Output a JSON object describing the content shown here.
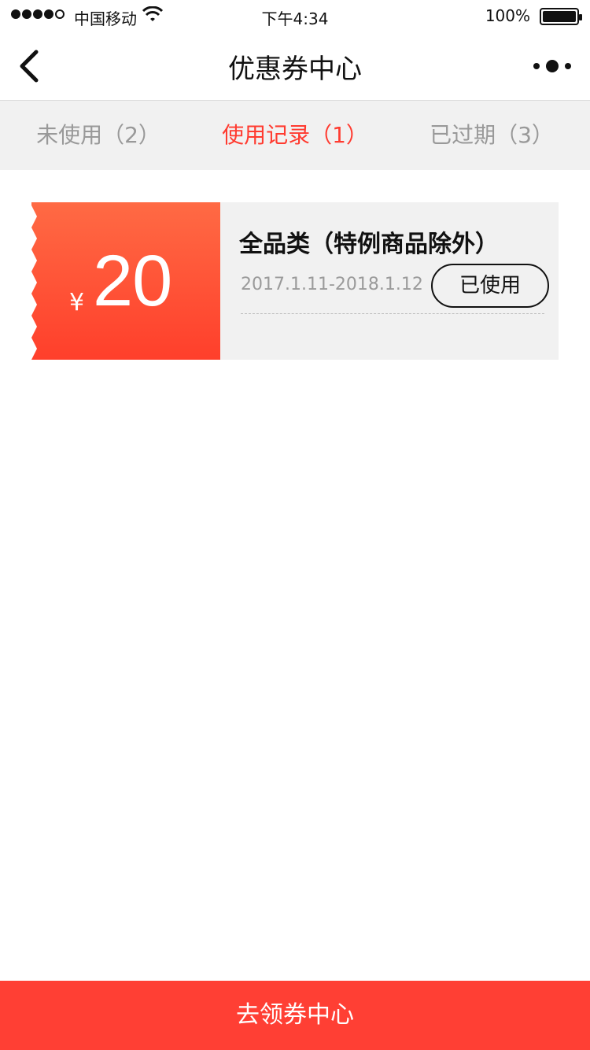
{
  "status_bar": {
    "carrier": "中国移动",
    "time": "下午4:34",
    "battery": "100%"
  },
  "nav": {
    "title": "优惠券中心",
    "back_icon": "chevron-left-icon",
    "more_icon": "more-options-icon"
  },
  "tabs": [
    {
      "label": "未使用（2）"
    },
    {
      "label": "使用记录（1）"
    },
    {
      "label": "已过期（3）"
    }
  ],
  "coupon": {
    "currency": "¥",
    "amount": "20",
    "title": "全品类（特例商品除外）",
    "date_range": "2017.1.11-2018.1.12",
    "status": "已使用"
  },
  "bottom_cta": {
    "label": "去领券中心"
  },
  "colors": {
    "accent": "#ff3b30"
  }
}
